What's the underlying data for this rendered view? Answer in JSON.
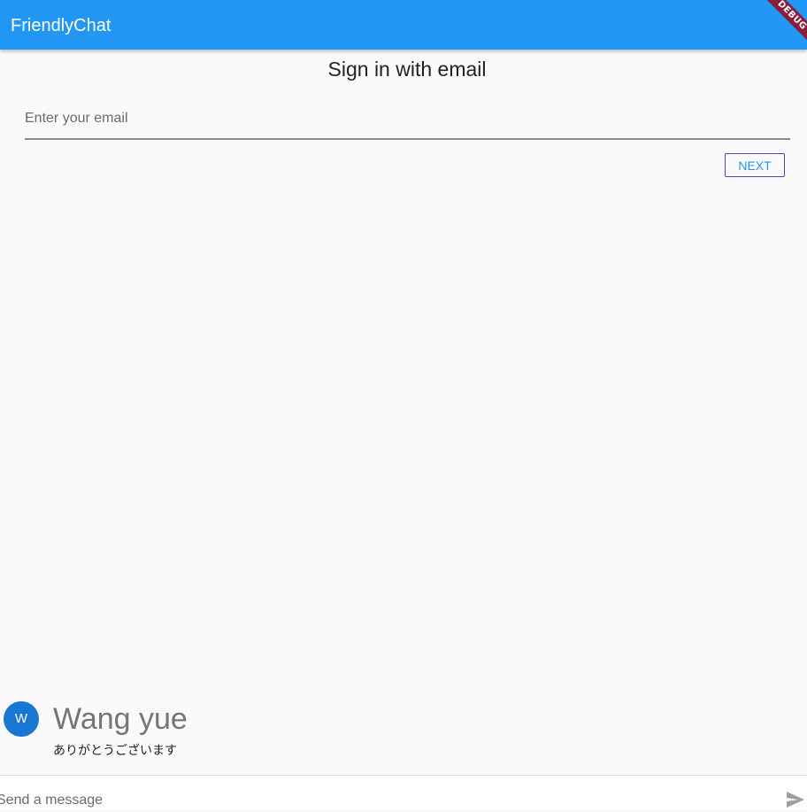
{
  "appbar": {
    "title": "FriendlyChat",
    "debug_label": "DEBUG"
  },
  "signin": {
    "title": "Sign in with email",
    "email_placeholder": "Enter your email",
    "next_label": "NEXT"
  },
  "messages": [
    {
      "avatar_initial": "W",
      "sender": "Wang yue",
      "text": "ありがとうございます"
    }
  ],
  "composer": {
    "placeholder": "Send a message",
    "send_icon": "send-icon"
  },
  "colors": {
    "appbar": "#2196f3",
    "avatar": "#1976d2",
    "next_border": "#5b3cc4",
    "debug_banner": "#8b1c3a"
  }
}
